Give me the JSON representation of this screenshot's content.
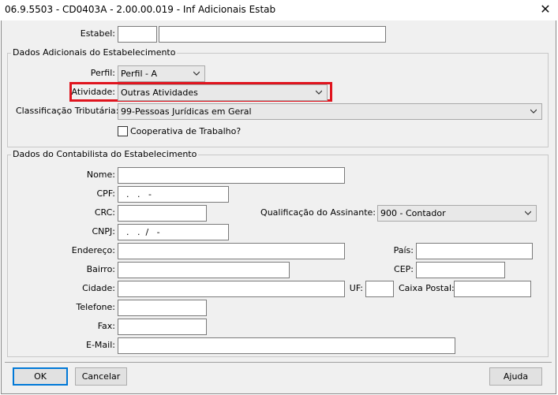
{
  "window": {
    "title": "06.9.5503 - CD0403A - 2.00.00.019 - Inf Adicionais Estab"
  },
  "estabel": {
    "label": "Estabel:",
    "code": "",
    "name": ""
  },
  "dados_adicionais": {
    "title": "Dados Adicionais do Estabelecimento",
    "perfil_label": "Perfil:",
    "perfil_value": "Perfil - A",
    "atividade_label": "Atividade:",
    "atividade_value": "Outras Atividades",
    "classificacao_label": "Classificação Tributária:",
    "classificacao_value": "99-Pessoas Jurídicas em Geral",
    "cooperativa_label": "Cooperativa de Trabalho?"
  },
  "contabilista": {
    "title": "Dados do Contabilista do Estabelecimento",
    "nome_label": "Nome:",
    "cpf_label": "CPF:",
    "cpf_value": "  .   .   -",
    "crc_label": "CRC:",
    "cnpj_label": "CNPJ:",
    "cnpj_value": "  .   .  /   -",
    "qualificacao_label": "Qualificação do Assinante:",
    "qualificacao_value": "900 - Contador",
    "endereco_label": "Endereço:",
    "pais_label": "País:",
    "bairro_label": "Bairro:",
    "cep_label": "CEP:",
    "cidade_label": "Cidade:",
    "uf_label": "UF:",
    "caixa_postal_label": "Caixa Postal:",
    "telefone_label": "Telefone:",
    "fax_label": "Fax:",
    "email_label": "E-Mail:"
  },
  "buttons": {
    "ok": "OK",
    "cancelar": "Cancelar",
    "ajuda": "Ajuda"
  },
  "colors": {
    "highlight": "#e0141e",
    "default_button_border": "#0078d7"
  },
  "icons": {
    "close": "close-icon",
    "dropdown": "chevron-down-icon"
  }
}
